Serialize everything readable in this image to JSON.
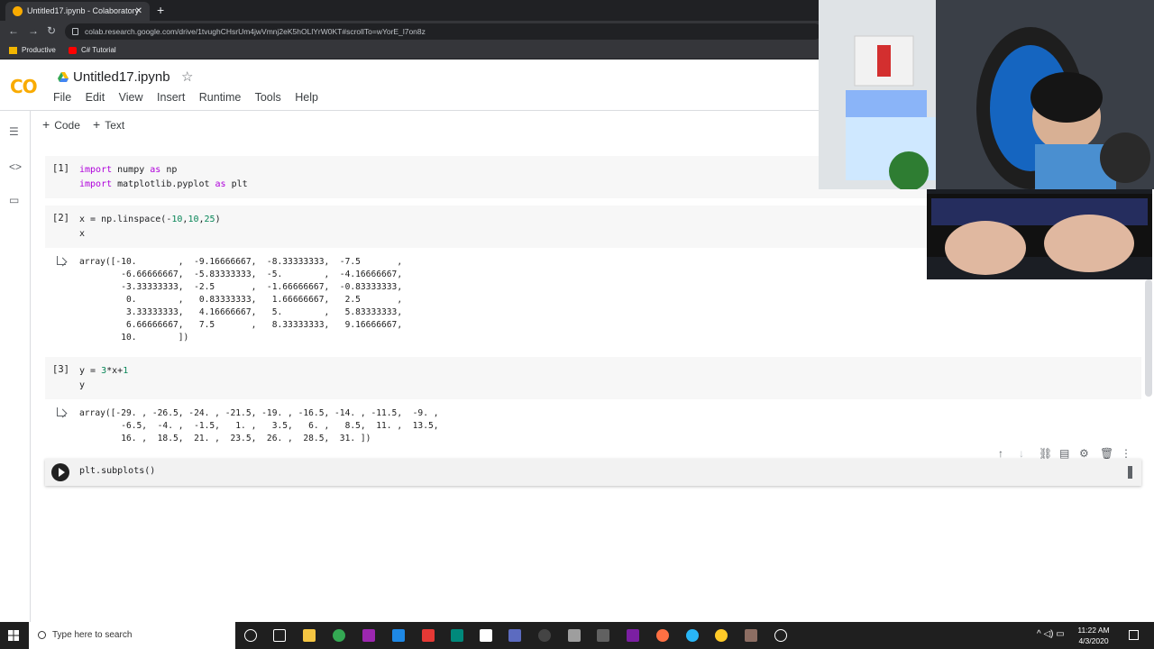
{
  "browser": {
    "tab_title": "Untitled17.ipynb - Colaboratory",
    "tab_close": "✕",
    "new_tab": "+",
    "url": "colab.research.google.com/drive/1tvughCHsrUm4jwVmnj2eK5hOLlYrW0KT#scrollTo=wYorE_l7on8z",
    "bookmarks": [
      {
        "label": "Productive",
        "color": "#f2b600"
      },
      {
        "label": "C# Tutorial",
        "color": "#ff0000"
      }
    ]
  },
  "colab": {
    "logo": "CO",
    "title": "Untitled17.ipynb",
    "star": "☆",
    "menu": [
      "File",
      "Edit",
      "View",
      "Insert",
      "Runtime",
      "Tools",
      "Help"
    ],
    "toolbar": {
      "add_code": "Code",
      "add_text": "Text",
      "plus": "+"
    },
    "accent": "#f9ab00"
  },
  "cells": [
    {
      "number": "[1]",
      "code_lines": [
        [
          {
            "t": "import",
            "c": "kw"
          },
          {
            "t": " numpy "
          },
          {
            "t": "as",
            "c": "kw"
          },
          {
            "t": " np"
          }
        ],
        [
          {
            "t": "import",
            "c": "kw"
          },
          {
            "t": " matplotlib.pyplot "
          },
          {
            "t": "as",
            "c": "kw"
          },
          {
            "t": " plt"
          }
        ]
      ]
    },
    {
      "number": "[2]",
      "code_lines": [
        [
          {
            "t": "x = np.linspace(-"
          },
          {
            "t": "10",
            "c": "num"
          },
          {
            "t": ","
          },
          {
            "t": "10",
            "c": "num"
          },
          {
            "t": ","
          },
          {
            "t": "25",
            "c": "num"
          },
          {
            "t": ")"
          }
        ],
        [
          {
            "t": "x"
          }
        ]
      ],
      "output": "array([-10.        ,  -9.16666667,  -8.33333333,  -7.5       ,\n        -6.66666667,  -5.83333333,  -5.        ,  -4.16666667,\n        -3.33333333,  -2.5       ,  -1.66666667,  -0.83333333,\n         0.        ,   0.83333333,   1.66666667,   2.5       ,\n         3.33333333,   4.16666667,   5.        ,   5.83333333,\n         6.66666667,   7.5       ,   8.33333333,   9.16666667,\n        10.        ])"
    },
    {
      "number": "[3]",
      "code_lines": [
        [
          {
            "t": "y = "
          },
          {
            "t": "3",
            "c": "num"
          },
          {
            "t": "*x+"
          },
          {
            "t": "1",
            "c": "num"
          }
        ],
        [
          {
            "t": "y"
          }
        ]
      ],
      "output": "array([-29. , -26.5, -24. , -21.5, -19. , -16.5, -14. , -11.5,  -9. ,\n        -6.5,  -4. ,  -1.5,   1. ,   3.5,   6. ,   8.5,  11. ,  13.5,\n        16. ,  18.5,  21. ,  23.5,  26. ,  28.5,  31. ])"
    }
  ],
  "active_cell": {
    "code": "plt.subplots()"
  },
  "cell_toolbar_icons": [
    "arrow-up-icon",
    "arrow-down-icon",
    "link-icon",
    "comment-icon",
    "settings-icon",
    "delete-icon",
    "more-icon"
  ],
  "taskbar": {
    "search_placeholder": "Type here to search",
    "time": "11:22 AM",
    "date": "4/3/2020",
    "tray": "^  ◁)  ▭"
  }
}
